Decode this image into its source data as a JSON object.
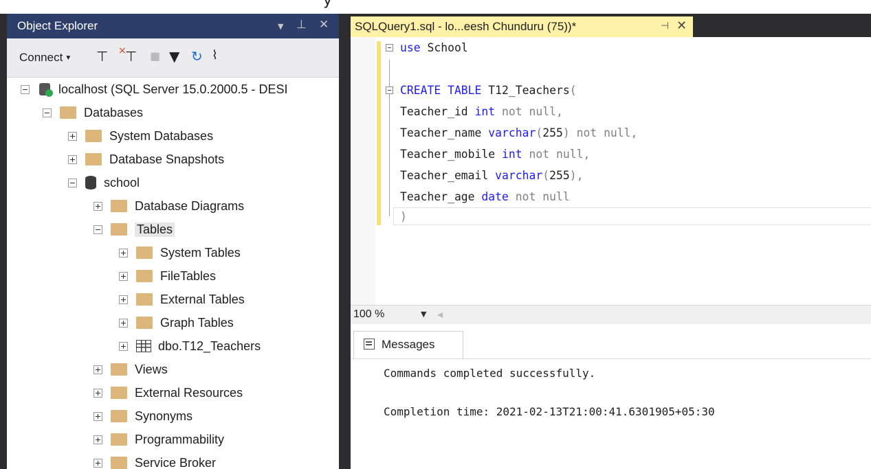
{
  "object_explorer": {
    "title": "Object Explorer",
    "connect_label": "Connect",
    "tree": {
      "server": "localhost (SQL Server 15.0.2000.5 - DESI",
      "databases": "Databases",
      "system_databases": "System Databases",
      "database_snapshots": "Database Snapshots",
      "school": "school",
      "database_diagrams": "Database Diagrams",
      "tables": "Tables",
      "system_tables": "System Tables",
      "filetables": "FileTables",
      "external_tables": "External Tables",
      "graph_tables": "Graph Tables",
      "t12_teachers": "dbo.T12_Teachers",
      "views": "Views",
      "external_resources": "External Resources",
      "synonyms": "Synonyms",
      "programmability": "Programmability",
      "service_broker": "Service Broker"
    }
  },
  "editor": {
    "tab_title": "SQLQuery1.sql - lo...eesh Chunduru (75))*",
    "code": {
      "line1_kw": "use",
      "line1_rest": " School",
      "line3_kw": "CREATE TABLE",
      "line3_rest": " T12_Teachers",
      "line3_paren": "(",
      "c1_name": "Teacher_id ",
      "c1_type": "int",
      "c1_rest": " not null,",
      "c2_name": "Teacher_name ",
      "c2_type": "varchar",
      "c2_open": "(",
      "c2_num": "255",
      "c2_rest": ") not null,",
      "c3_name": "Teacher_mobile ",
      "c3_type": "int",
      "c3_rest": " not null,",
      "c4_name": "Teacher_email ",
      "c4_type": "varchar",
      "c4_open": "(",
      "c4_num": "255",
      "c4_rest": "),",
      "c5_name": "Teacher_age ",
      "c5_type": "date",
      "c5_rest": " not null",
      "close_paren": ")"
    },
    "zoom": "100 %"
  },
  "results": {
    "tab_label": "Messages",
    "line1": "Commands completed successfully.",
    "line2": "Completion time: 2021-02-13T21:00:41.6301905+05:30"
  },
  "colors": {
    "keyword": "#1c1cff",
    "gray_keyword": "#808080",
    "tab_active": "#fff1a8",
    "oe_title": "#2d3e6a"
  }
}
